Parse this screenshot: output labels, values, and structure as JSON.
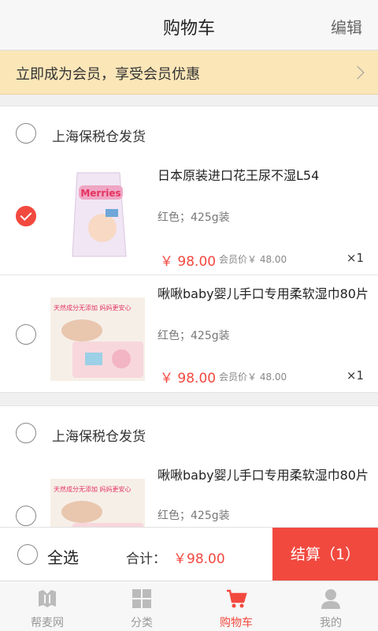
{
  "header": {
    "title": "购物车",
    "edit_label": "编辑"
  },
  "member_banner": {
    "text": "立即成为会员，享受会员优惠"
  },
  "stores": [
    {
      "name": "上海保税仓发货",
      "items": [
        {
          "title": "日本原装进口花王尿不湿L54",
          "spec": "红色；425g装",
          "price": "￥ 98.00",
          "member_price": "会员价￥ 48.00",
          "qty": "×1",
          "checked": true,
          "thumb_text": "Merries"
        },
        {
          "title": "啾啾baby婴儿手口专用柔软湿巾80片",
          "spec": "红色；425g装",
          "price": "￥ 98.00",
          "member_price": "会员价￥ 48.00",
          "qty": "×1",
          "checked": false,
          "thumb_text": "天然成分无添加 妈妈更安心"
        }
      ]
    },
    {
      "name": "上海保税仓发货",
      "items": [
        {
          "title": "啾啾baby婴儿手口专用柔软湿巾80片",
          "spec": "红色；425g装",
          "checked": false,
          "thumb_text": "天然成分无添加 妈妈更安心"
        }
      ]
    }
  ],
  "bottom_bar": {
    "select_all": "全选",
    "total_label": "合计：",
    "total_value": "￥98.00",
    "checkout_label": "结算（1）"
  },
  "tabs": [
    {
      "label": "帮麦网",
      "icon": "home-logo-icon",
      "active": false
    },
    {
      "label": "分类",
      "icon": "category-grid-icon",
      "active": false
    },
    {
      "label": "购物车",
      "icon": "cart-icon",
      "active": true
    },
    {
      "label": "我的",
      "icon": "user-icon",
      "active": false
    }
  ],
  "colors": {
    "accent": "#f2493f",
    "banner": "#fbe6b8"
  }
}
